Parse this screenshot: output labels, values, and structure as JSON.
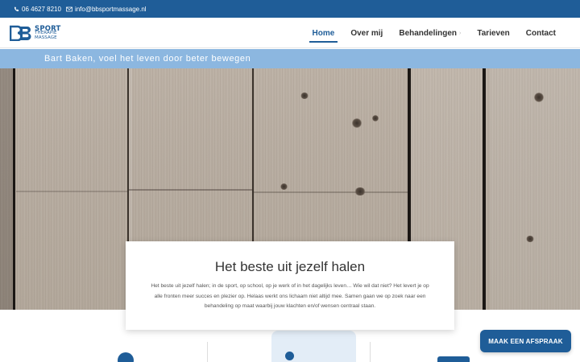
{
  "topbar": {
    "phone": "06 4627 8210",
    "email": "info@bbsportmassage.nl"
  },
  "logo": {
    "line1": "SPORT",
    "line2": "THERAPIE",
    "line3": "MASSAGE"
  },
  "nav": {
    "items": [
      {
        "label": "Home",
        "active": true
      },
      {
        "label": "Over mij"
      },
      {
        "label": "Behandelingen",
        "has_dropdown": true
      },
      {
        "label": "Tarieven"
      },
      {
        "label": "Contact"
      }
    ]
  },
  "tagline": "Bart Baken, voel het leven door beter bewegen",
  "intro": {
    "title": "Het beste uit jezelf halen",
    "body": "Het beste uit jezelf halen; in de sport, op school, op je werk of in het dagelijks leven… Wie wil dat niet? Het levert je op alle fronten meer succes en plezier op. Helaas werkt ons lichaam niet altijd mee. Samen gaan we op zoek naar een behandeling op maat waarbij jouw klachten en/of wensen centraal staan."
  },
  "cta": {
    "label": "MAAK EEN AFSPRAAK"
  },
  "colors": {
    "brand": "#1f5d98",
    "tagline_band": "#8cb7e0"
  }
}
